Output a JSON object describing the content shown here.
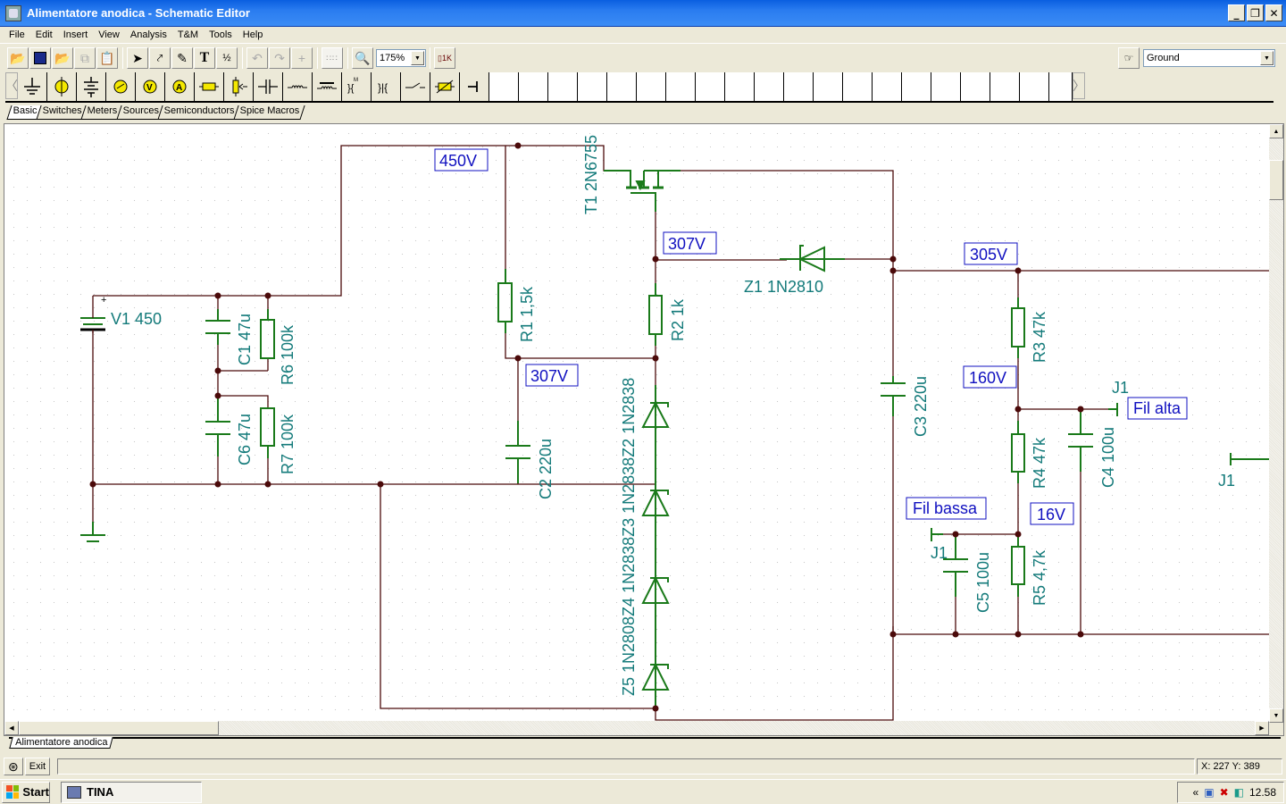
{
  "window": {
    "title": "Alimentatore anodica - Schematic Editor",
    "controls": [
      "minimize",
      "restore",
      "close"
    ]
  },
  "menu": [
    "File",
    "Edit",
    "Insert",
    "View",
    "Analysis",
    "T&M",
    "Tools",
    "Help"
  ],
  "toolbar": {
    "buttons": [
      "open-icon",
      "save-icon",
      "open-macro-icon",
      "copy-icon",
      "paste-icon",
      "select-arrow-icon",
      "wire-icon",
      "pencil-icon",
      "text-icon",
      "formula-icon",
      "undo-icon",
      "redo-icon",
      "cross-icon",
      "grid-icon",
      "zoom-icon"
    ],
    "zoom_value": "175%",
    "parameter_icon": "component-value-icon",
    "hint_icon": "pointing-hand-icon",
    "selected_component": "Ground"
  },
  "parts": {
    "icons": [
      "ground-icon",
      "current-source-icon",
      "battery-icon",
      "voltage-generator-icon",
      "voltmeter-icon",
      "ammeter-icon",
      "resistor-icon",
      "potentiometer-icon",
      "capacitor-icon",
      "inductor-icon",
      "inductor-core-icon",
      "transformer-m-icon",
      "transformer-icon",
      "switch-icon",
      "thermistor-icon",
      "jumper-icon"
    ],
    "tabs": [
      "Basic",
      "Switches",
      "Meters",
      "Sources",
      "Semiconductors",
      "Spice Macros"
    ],
    "active_tab": "Basic"
  },
  "schematic": {
    "components": {
      "v1": "V1 450",
      "c1": "C1 47u",
      "c6": "C6 47u",
      "r6": "R6 100k",
      "r7": "R7 100k",
      "r1": "R1 1,5k",
      "r2": "R2 1k",
      "c2": "C2 220u",
      "t1": "T1 2N6755",
      "z1": "Z1 1N2810",
      "zener_chain": "Z5 1N2808Z4 1N2838Z3 1N2838Z2 1N2838",
      "c3": "C3 220u",
      "r3": "R3 47k",
      "r4": "R4 47k",
      "r5": "R5 4,7k",
      "c4": "C4 100u",
      "c5": "C5 100u",
      "j1_a": "J1",
      "j1_b": "J1",
      "j1_c": "J1"
    },
    "labels": {
      "v450": "450V",
      "v307_top": "307V",
      "v307_mid": "307V",
      "v305": "305V",
      "v160": "160V",
      "v16": "16V",
      "fil_alta": "Fil alta",
      "fil_bassa": "Fil bassa"
    },
    "colors": {
      "wire": "#4b0a0a",
      "component": "#1a7a1a",
      "label_text": "#137a7a",
      "voltage_text": "#1010c0",
      "node": "#4b0a0a"
    }
  },
  "document_tabs": [
    "Alimentatore anodica"
  ],
  "status": {
    "exit_label": "Exit",
    "coordinates": "X: 227  Y: 389"
  },
  "taskbar": {
    "start_label": "Start",
    "task_label": "TINA",
    "clock": "12.58"
  }
}
